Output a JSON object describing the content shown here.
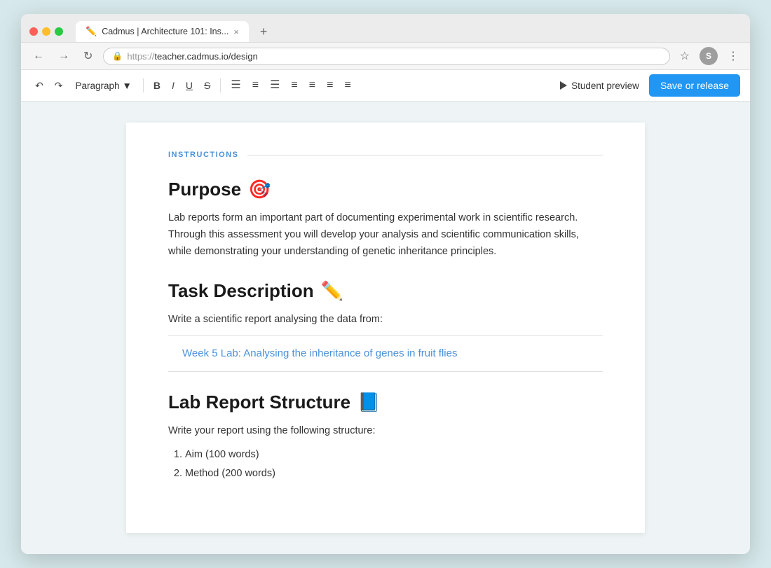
{
  "browser": {
    "tab_title": "Cadmus | Architecture 101: Ins...",
    "url": "https://teacher.cadmus.io/design",
    "url_protocol": "https://",
    "url_domain": "teacher.cadmus.io",
    "url_path": "/design",
    "new_tab_icon": "+",
    "tab_close_icon": "×",
    "avatar_letter": "S"
  },
  "toolbar": {
    "paragraph_label": "Paragraph",
    "bold_label": "B",
    "italic_label": "I",
    "underline_label": "U",
    "strikethrough_label": "S",
    "student_preview_label": "Student preview",
    "save_release_label": "Save or release",
    "align_icons": [
      "≡",
      "≡",
      "≡",
      "≡",
      "≡",
      "≡",
      "≡"
    ]
  },
  "content": {
    "instructions_label": "INSTRUCTIONS",
    "sections": [
      {
        "id": "purpose",
        "heading": "Purpose",
        "emoji": "🎯",
        "body": "Lab reports form an important part of documenting experimental work in scientific research. Through this assessment you will develop your analysis and scientific communication skills, while demonstrating your understanding of genetic inheritance principles."
      },
      {
        "id": "task-description",
        "heading": "Task Description",
        "emoji": "✏️",
        "body": "Write a scientific report analysing the data from:",
        "link_text": "Week 5 Lab: Analysing the inheritance of genes in fruit flies"
      },
      {
        "id": "lab-report-structure",
        "heading": "Lab Report Structure",
        "emoji": "📘",
        "body": "Write your report using the following structure:",
        "list_items": [
          "Aim (100 words)",
          "Method (200 words)"
        ]
      }
    ]
  }
}
